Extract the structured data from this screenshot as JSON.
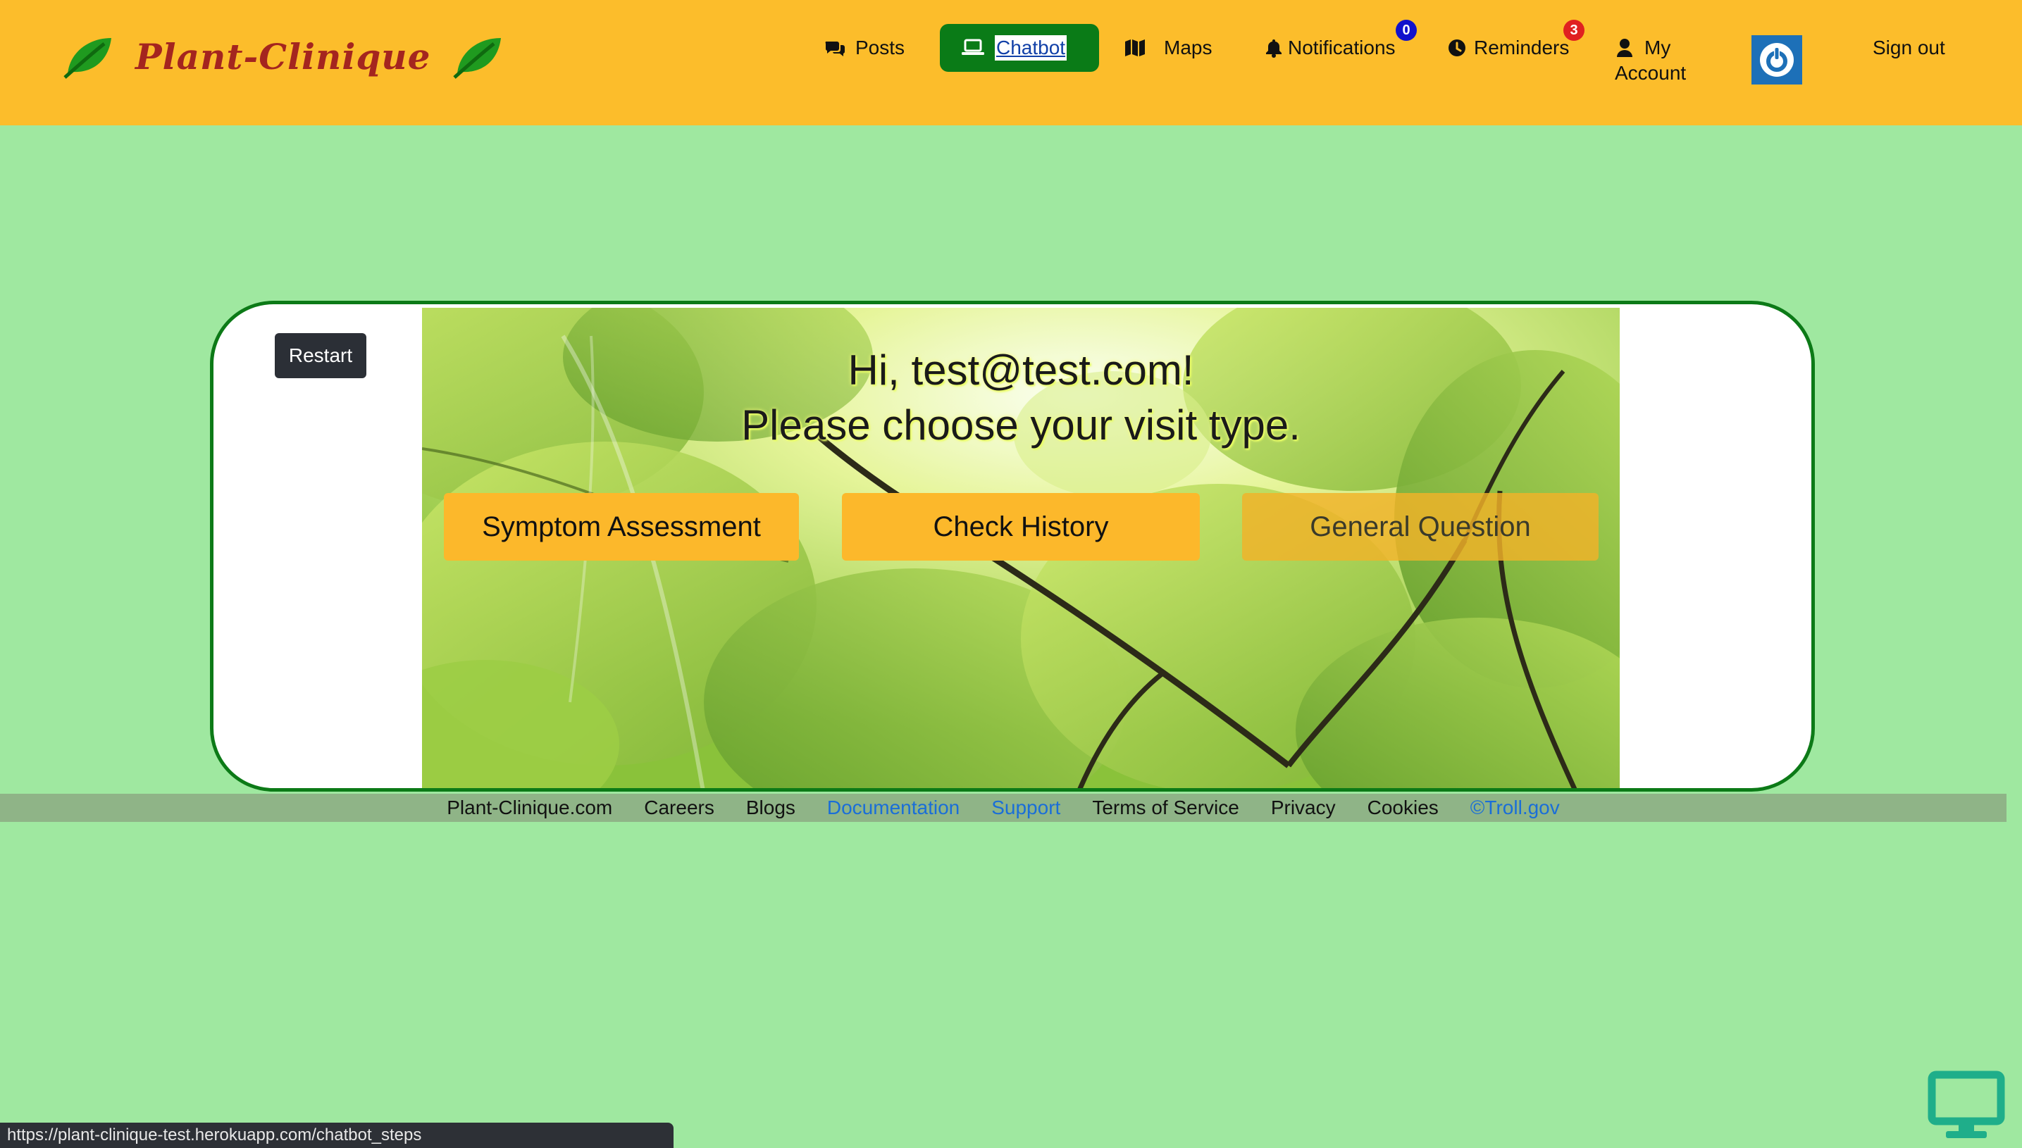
{
  "brand": {
    "name": "Plant-Clinique"
  },
  "nav": {
    "posts": "Posts",
    "chatbot": "Chatbot",
    "maps": "Maps",
    "notifications": "Notifications",
    "notifications_count": "0",
    "reminders": "Reminders",
    "reminders_count": "3",
    "account_line1": "My",
    "account_line2": "Account",
    "signout": "Sign out"
  },
  "chat": {
    "restart": "Restart",
    "greeting_line1": "Hi, test@test.com!",
    "greeting_line2": "Please choose your visit type.",
    "options": [
      "Symptom Assessment",
      "Check History",
      "General Question"
    ]
  },
  "footer": {
    "links": [
      "Plant-Clinique.com",
      "Careers",
      "Blogs",
      "Documentation",
      "Support",
      "Terms of Service",
      "Privacy",
      "Cookies",
      "©Troll.gov"
    ]
  },
  "status_url": "https://plant-clinique-test.herokuapp.com/chatbot_steps",
  "colors": {
    "navbar": "#fcbd2b",
    "page_bg": "#9fe8a0",
    "active_nav": "#0a7b17",
    "brand_text": "#a4251f",
    "card_border": "#0c7a17",
    "power_button": "#1d70b8",
    "notif_badge": "#1111cc",
    "reminder_badge": "#e02020"
  }
}
